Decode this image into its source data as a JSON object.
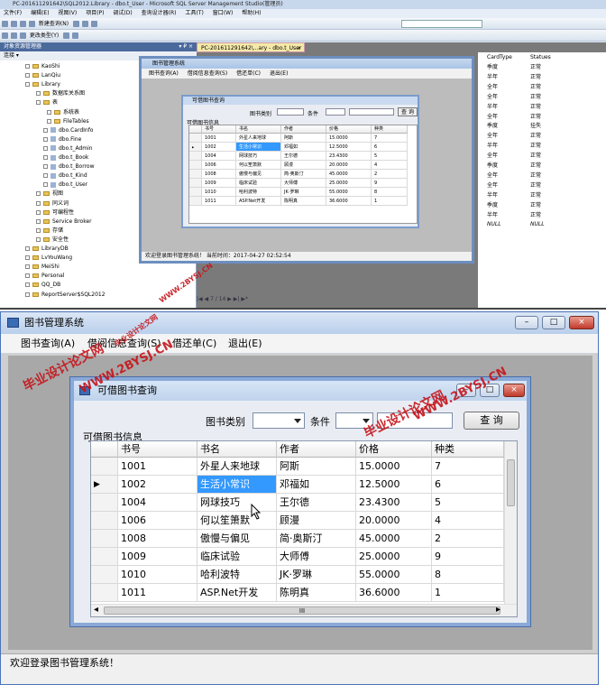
{
  "ssms": {
    "title": "PC-201611291642\\SQL2012.Library - dbo.t_User - Microsoft SQL Server Management Studio(管理员)",
    "menu": [
      "文件(F)",
      "编辑(E)",
      "视图(V)",
      "项目(P)",
      "调试(D)",
      "查询设计器(R)",
      "工具(T)",
      "窗口(W)",
      "帮助(H)"
    ],
    "toolbar_new_query": "新建查询(N)",
    "toolbar_change_type": "更改类型(Y)",
    "oe_header": "对象资源管理器",
    "oe_header_pin": "▾ ₽ ×",
    "oe_connect": "连接 ▾",
    "tree": [
      {
        "label": "KaoShi",
        "kind": "db"
      },
      {
        "label": "LanQiu",
        "kind": "db"
      },
      {
        "label": "Library",
        "kind": "db"
      },
      {
        "label": "数据库关系图",
        "kind": "folder"
      },
      {
        "label": "表",
        "kind": "folder"
      },
      {
        "label": "系统表",
        "kind": "folder"
      },
      {
        "label": "FileTables",
        "kind": "folder"
      },
      {
        "label": "dbo.CardInfo",
        "kind": "table"
      },
      {
        "label": "dbo.Fine",
        "kind": "table"
      },
      {
        "label": "dbo.t_Admin",
        "kind": "table"
      },
      {
        "label": "dbo.t_Book",
        "kind": "table"
      },
      {
        "label": "dbo.t_Borrow",
        "kind": "table"
      },
      {
        "label": "dbo.t_Kind",
        "kind": "table"
      },
      {
        "label": "dbo.t_User",
        "kind": "table"
      },
      {
        "label": "视图",
        "kind": "folder"
      },
      {
        "label": "同义词",
        "kind": "folder"
      },
      {
        "label": "可编程性",
        "kind": "folder"
      },
      {
        "label": "Service Broker",
        "kind": "folder"
      },
      {
        "label": "存储",
        "kind": "folder"
      },
      {
        "label": "安全性",
        "kind": "folder"
      },
      {
        "label": "LibraryDB",
        "kind": "db"
      },
      {
        "label": "LvYouWang",
        "kind": "db"
      },
      {
        "label": "MeiShi",
        "kind": "db"
      },
      {
        "label": "Personal",
        "kind": "db"
      },
      {
        "label": "QQ_DB",
        "kind": "db"
      },
      {
        "label": "ReportServer$SQL2012",
        "kind": "db"
      }
    ],
    "doc_tab": "PC-201611291642\\...ary - dbo.t_User",
    "doc_tab_close": "×",
    "right_grid_headers": [
      "CardType",
      "Statues"
    ],
    "right_grid_rows": [
      [
        "季度",
        "正常"
      ],
      [
        "半年",
        "正常"
      ],
      [
        "全年",
        "正常"
      ],
      [
        "全年",
        "正常"
      ],
      [
        "半年",
        "正常"
      ],
      [
        "全年",
        "正常"
      ],
      [
        "季度",
        "挂失"
      ],
      [
        "全年",
        "正常"
      ],
      [
        "半年",
        "正常"
      ],
      [
        "全年",
        "正常"
      ],
      [
        "季度",
        "正常"
      ],
      [
        "全年",
        "正常"
      ],
      [
        "全年",
        "正常"
      ],
      [
        "半年",
        "正常"
      ],
      [
        "季度",
        "正常"
      ],
      [
        "半年",
        "正常"
      ],
      [
        "NULL",
        "NULL"
      ]
    ],
    "pager": "|◀ ◀ 7 / 14 ▶ ▶| ▶*",
    "small_window": {
      "title": "图书管理系统",
      "menu": [
        "图书查询(A)",
        "借阅信息查询(S)",
        "借还单(C)",
        "退出(E)"
      ],
      "status": "欢迎登录图书管理系统！ 当前时间：2017-04-27 02:52:54"
    }
  },
  "app": {
    "title": "图书管理系统",
    "title_buttons": {
      "minimize": "–",
      "maximize": "□",
      "close": "×"
    },
    "menu": [
      "图书查询(A)",
      "借阅信息查询(S)",
      "借还单(C)",
      "退出(E)"
    ],
    "status_text": "欢迎登录图书管理系统！"
  },
  "dialog": {
    "title": "可借图书查询",
    "title_buttons": {
      "minimize": "–",
      "maximize": "□",
      "close": "×"
    },
    "category_label": "图书类别",
    "condition_label": "条件",
    "search_button": "查 询",
    "group_label": "可借图书信息",
    "columns": [
      "书号",
      "书名",
      "作者",
      "价格",
      "种类"
    ],
    "rows": [
      [
        "1001",
        "外星人来地球",
        "阿斯",
        "15.0000",
        "7"
      ],
      [
        "1002",
        "生活小常识",
        "邓福如",
        "12.5000",
        "6"
      ],
      [
        "1004",
        "网球技巧",
        "王尔德",
        "23.4300",
        "5"
      ],
      [
        "1006",
        "何以笙箫默",
        "顾漫",
        "20.0000",
        "4"
      ],
      [
        "1008",
        "傲慢与偏见",
        "简·奥斯汀",
        "45.0000",
        "2"
      ],
      [
        "1009",
        "临床试验",
        "大师傅",
        "25.0000",
        "9"
      ],
      [
        "1010",
        "哈利波特",
        "JK·罗琳",
        "55.0000",
        "8"
      ],
      [
        "1011",
        "ASP.Net开发",
        "陈明真",
        "36.6000",
        "1"
      ]
    ],
    "selected_row_index": 1,
    "row_indicator": "▶",
    "hscroll_grip": "III",
    "hscroll_left": "◂",
    "hscroll_right": "▸"
  },
  "watermarks": [
    "毕业设计论文网",
    "WWW.2BYSJ.CN"
  ],
  "colors": {
    "watermark": "#c5141a",
    "selection": "#3399ff",
    "window_border": "#4a74b8"
  }
}
